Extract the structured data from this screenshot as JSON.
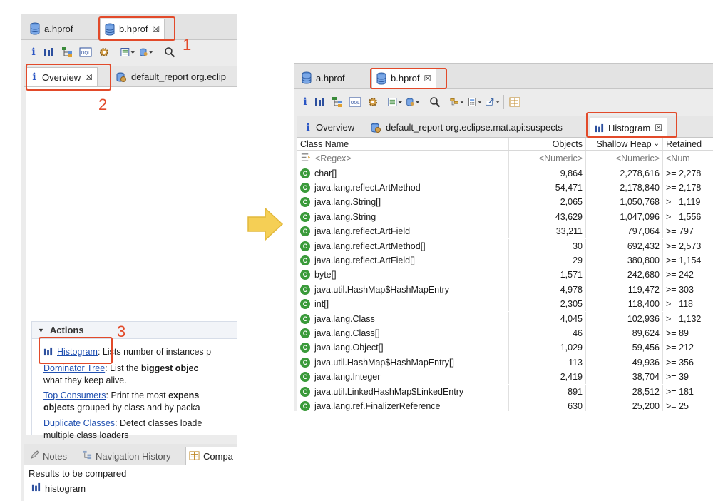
{
  "left_panel": {
    "file_tabs": [
      {
        "label": "a.hprof"
      },
      {
        "label": "b.hprof"
      }
    ],
    "editor_tabs": [
      {
        "label": "Overview"
      },
      {
        "label": "default_report  org.eclip"
      }
    ],
    "actions": {
      "title": "Actions",
      "items": [
        {
          "link": "Histogram",
          "text_1": ": Lists number of instances p"
        },
        {
          "link": "Dominator Tree",
          "text_1": ": List the ",
          "bold_1": "biggest objec",
          "line_2": "what they keep alive."
        },
        {
          "link": "Top Consumers",
          "text_1": ": Print the most ",
          "bold_1": "expens",
          "bold_2": "objects",
          "line_2": " grouped by class and by packa"
        },
        {
          "link": "Duplicate Classes",
          "text_1": ": Detect classes loade",
          "line_2": "multiple class loaders"
        }
      ]
    },
    "view_tabs": [
      {
        "label": "Notes"
      },
      {
        "label": "Navigation History"
      },
      {
        "label": "Compa"
      }
    ],
    "compare": {
      "heading": "Results to be compared",
      "item": "histogram"
    }
  },
  "annotations": {
    "n1": "1",
    "n2": "2",
    "n3": "3"
  },
  "right_panel": {
    "file_tabs": [
      {
        "label": "a.hprof"
      },
      {
        "label": "b.hprof"
      }
    ],
    "editor_tabs": [
      {
        "label": "Overview"
      },
      {
        "label": "default_report  org.eclipse.mat.api:suspects"
      },
      {
        "label": "Histogram"
      }
    ],
    "table": {
      "columns": [
        "Class Name",
        "Objects",
        "Shallow Heap",
        "Retained"
      ],
      "filter": {
        "name": "<Regex>",
        "objects": "<Numeric>",
        "shallow": "<Numeric>",
        "retained": "<Num"
      },
      "rows": [
        {
          "name": "char[]",
          "objects": "9,864",
          "shallow": "2,278,616",
          "retained": ">= 2,278"
        },
        {
          "name": "java.lang.reflect.ArtMethod",
          "objects": "54,471",
          "shallow": "2,178,840",
          "retained": ">= 2,178"
        },
        {
          "name": "java.lang.String[]",
          "objects": "2,065",
          "shallow": "1,050,768",
          "retained": ">= 1,119"
        },
        {
          "name": "java.lang.String",
          "objects": "43,629",
          "shallow": "1,047,096",
          "retained": ">= 1,556"
        },
        {
          "name": "java.lang.reflect.ArtField",
          "objects": "33,211",
          "shallow": "797,064",
          "retained": ">= 797"
        },
        {
          "name": "java.lang.reflect.ArtMethod[]",
          "objects": "30",
          "shallow": "692,432",
          "retained": ">= 2,573"
        },
        {
          "name": "java.lang.reflect.ArtField[]",
          "objects": "29",
          "shallow": "380,800",
          "retained": ">= 1,154"
        },
        {
          "name": "byte[]",
          "objects": "1,571",
          "shallow": "242,680",
          "retained": ">= 242"
        },
        {
          "name": "java.util.HashMap$HashMapEntry",
          "objects": "4,978",
          "shallow": "119,472",
          "retained": ">= 303"
        },
        {
          "name": "int[]",
          "objects": "2,305",
          "shallow": "118,400",
          "retained": ">= 118"
        },
        {
          "name": "java.lang.Class",
          "objects": "4,045",
          "shallow": "102,936",
          "retained": ">= 1,132"
        },
        {
          "name": "java.lang.Class[]",
          "objects": "46",
          "shallow": "89,624",
          "retained": ">= 89"
        },
        {
          "name": "java.lang.Object[]",
          "objects": "1,029",
          "shallow": "59,456",
          "retained": ">= 212"
        },
        {
          "name": "java.util.HashMap$HashMapEntry[]",
          "objects": "113",
          "shallow": "49,936",
          "retained": ">= 356"
        },
        {
          "name": "java.lang.Integer",
          "objects": "2,419",
          "shallow": "38,704",
          "retained": ">= 39"
        },
        {
          "name": "java.util.LinkedHashMap$LinkedEntry",
          "objects": "891",
          "shallow": "28,512",
          "retained": ">= 181"
        },
        {
          "name": "java.lang.ref.FinalizerReference",
          "objects": "630",
          "shallow": "25,200",
          "retained": ">= 25"
        }
      ]
    }
  },
  "colors": {
    "highlight": "#e24a2a",
    "link": "#1f4fb0",
    "class_icon": "#3a9a3a",
    "arrow": "#f5cf55"
  }
}
